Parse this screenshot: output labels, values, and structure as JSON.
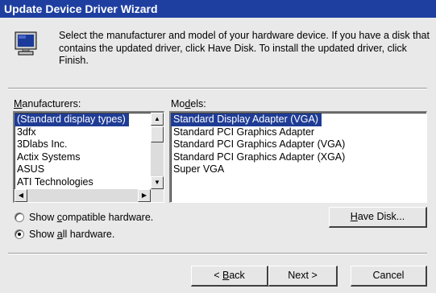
{
  "window": {
    "title": "Update Device Driver Wizard"
  },
  "header": {
    "icon": "monitor-icon",
    "instructions": "Select the manufacturer and model of your hardware device. If you have a disk that contains the updated driver, click Have Disk. To install the updated driver, click Finish."
  },
  "manufacturers": {
    "label_mnemonic": "M",
    "label_rest": "anufacturers:",
    "items": [
      "(Standard display types)",
      "3dfx",
      "3Dlabs Inc.",
      "Actix Systems",
      "ASUS",
      "ATI Technologies"
    ],
    "selected_index": 0
  },
  "models": {
    "label_pre": "Mo",
    "label_mnemonic": "d",
    "label_post": "els:",
    "items": [
      "Standard Display Adapter (VGA)",
      "Standard PCI Graphics Adapter",
      "Standard PCI Graphics Adapter (VGA)",
      "Standard PCI Graphics Adapter (XGA)",
      "Super VGA"
    ],
    "selected_index": 0
  },
  "options": {
    "compatible": {
      "pre": "Show ",
      "mnemonic": "c",
      "post": "ompatible hardware.",
      "checked": false
    },
    "all": {
      "pre": "Show ",
      "mnemonic": "a",
      "post": "ll hardware.",
      "checked": true
    }
  },
  "buttons": {
    "have_disk": {
      "mnemonic": "H",
      "rest": "ave Disk..."
    },
    "back": {
      "arrow": "<",
      "mnemonic": "B",
      "rest": "ack"
    },
    "next": {
      "label": "Next",
      "arrow": ">"
    },
    "cancel": {
      "label": "Cancel"
    }
  }
}
